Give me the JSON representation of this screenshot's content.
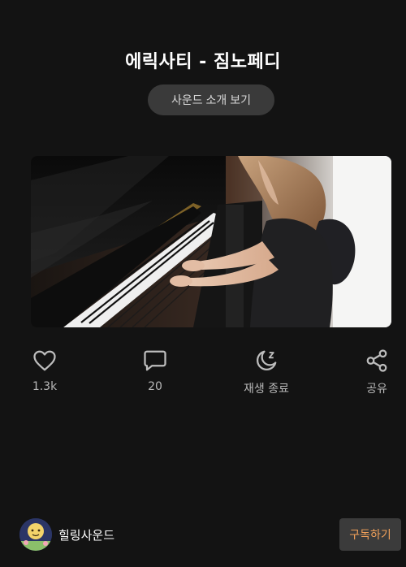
{
  "track": {
    "title": "에릭사티 - 짐노페디",
    "intro_button_label": "사운드 소개 보기"
  },
  "actions": [
    {
      "icon": "heart-icon",
      "label": "1.3k"
    },
    {
      "icon": "comment-icon",
      "label": "20"
    },
    {
      "icon": "moon-sleep-icon",
      "label": "재생 종료"
    },
    {
      "icon": "share-icon",
      "label": "공유"
    }
  ],
  "channel": {
    "name": "힐링사운드",
    "subscribe_label": "구독하기"
  },
  "colors": {
    "background": "#131313",
    "button_bg": "#3a3a3a",
    "subscribe_text": "#f2a15a"
  }
}
